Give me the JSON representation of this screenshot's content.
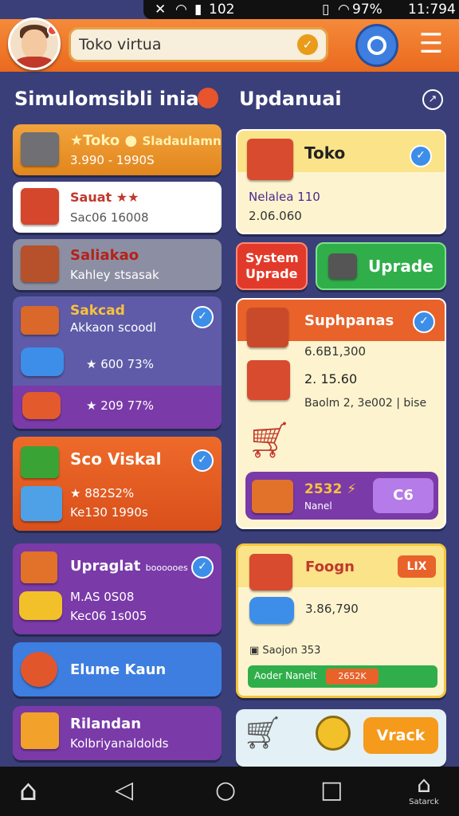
{
  "status": {
    "time": "11:794",
    "battery": "97%",
    "signal": "102"
  },
  "header": {
    "search_value": "Toko virtua"
  },
  "left_title": "Simulomsibli inia",
  "right_title": "Updanuai",
  "left_cards": [
    {
      "title": "Toko",
      "sub": "Sladaulamn",
      "value": "3.990 - 1990S"
    },
    {
      "title": "Sauat",
      "value": "Sac06 16008"
    },
    {
      "title": "Saliakao",
      "value": "Kahley stsasak"
    },
    {
      "title": "Sakcad",
      "sub": "Akkaon scoodl",
      "v1": "600 73%",
      "v2": "209 77%"
    },
    {
      "title": "Sco Viskal",
      "v1": "882S2%",
      "v2": "Ke130 1990s"
    },
    {
      "title": "Upraglat",
      "sub": "boooooes",
      "v1": "M.AS 0S08",
      "v2": "Kec06 1s005"
    },
    {
      "title": "Elume Kaun"
    },
    {
      "title": "Rilandan",
      "sub": "Kolbriyanaldolds"
    }
  ],
  "right_cards": {
    "toko": {
      "title": "Toko",
      "sub": "Nelalea 110",
      "value": "2.06.060"
    },
    "system_upgrade": "System Uprade",
    "upgrade": "Uprade",
    "suphpanas": {
      "title": "Suphpanas",
      "v1": "6.6B1,300",
      "v2": "2. 15.60",
      "v3": "Baolm 2, 3e002 | bise",
      "price": "2532",
      "price_sub": "Nanel",
      "btn": "C6"
    },
    "foogn": {
      "title": "Foogn",
      "badge": "LIX",
      "value": "3.86,790",
      "sub": "Saojon 353",
      "bar_label": "Aoder Nanelt",
      "bar_value": "2652K"
    },
    "vrack": "Vrack"
  },
  "nav": {
    "settings_label": "Satarck"
  },
  "colors": {
    "bg": "#3a3f7a",
    "orange": "#ea6a1f",
    "purple": "#7a3aa8",
    "green": "#2fae4a",
    "blue": "#3d7ee0"
  }
}
